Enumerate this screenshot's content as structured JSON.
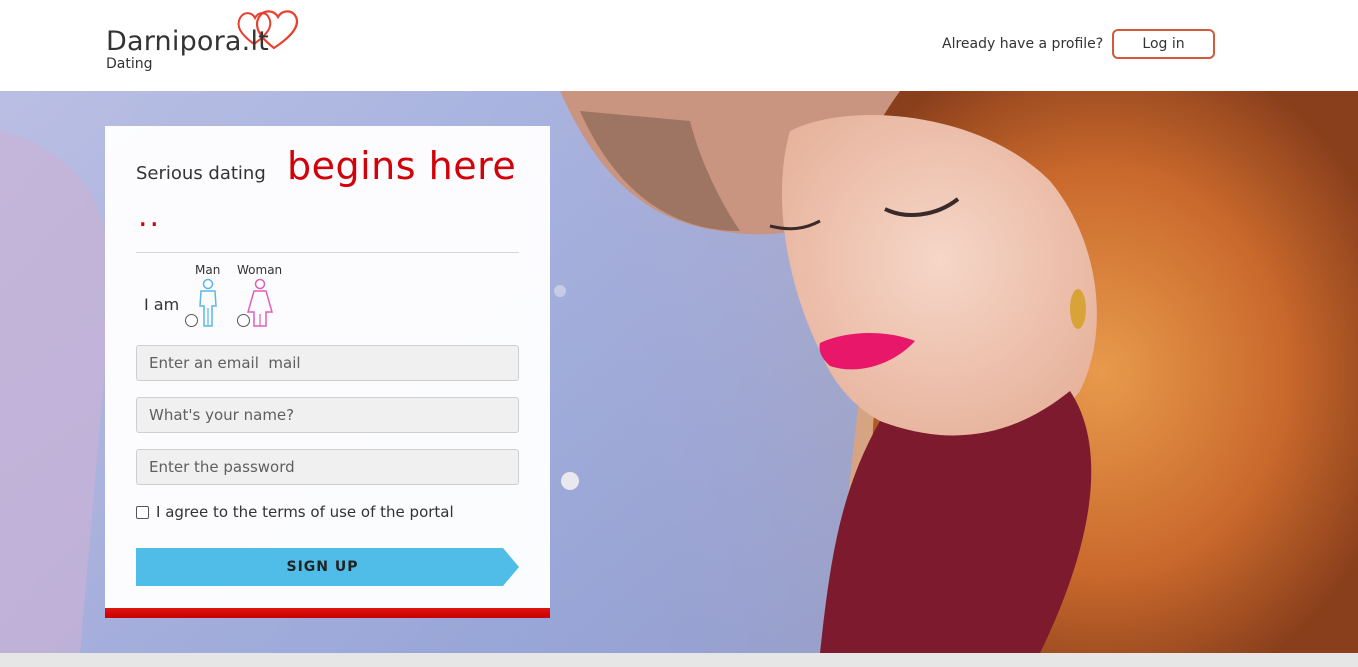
{
  "header": {
    "logo_title": "Darnipora.lt",
    "logo_subtitle": "Dating",
    "already_text": "Already have a profile?",
    "login_label": "Log in"
  },
  "form": {
    "serious_text": "Serious dating",
    "headline": "begins here",
    "dots": "..",
    "iam_label": "I am",
    "gender_man": "Man",
    "gender_woman": "Woman",
    "email_placeholder": "Enter an email  mail",
    "name_placeholder": "What's your name?",
    "password_placeholder": "Enter the password",
    "terms_label": "I agree to the terms of use of the portal",
    "signup_label": "SIGN UP"
  },
  "colors": {
    "accent_red": "#d0020a",
    "signup_blue": "#4fbde8",
    "login_border": "#d05a3a",
    "man_icon": "#5bb8e6",
    "woman_icon": "#e05fb8"
  },
  "icons": {
    "logo": "hearts-icon",
    "man": "man-icon",
    "woman": "woman-icon"
  }
}
